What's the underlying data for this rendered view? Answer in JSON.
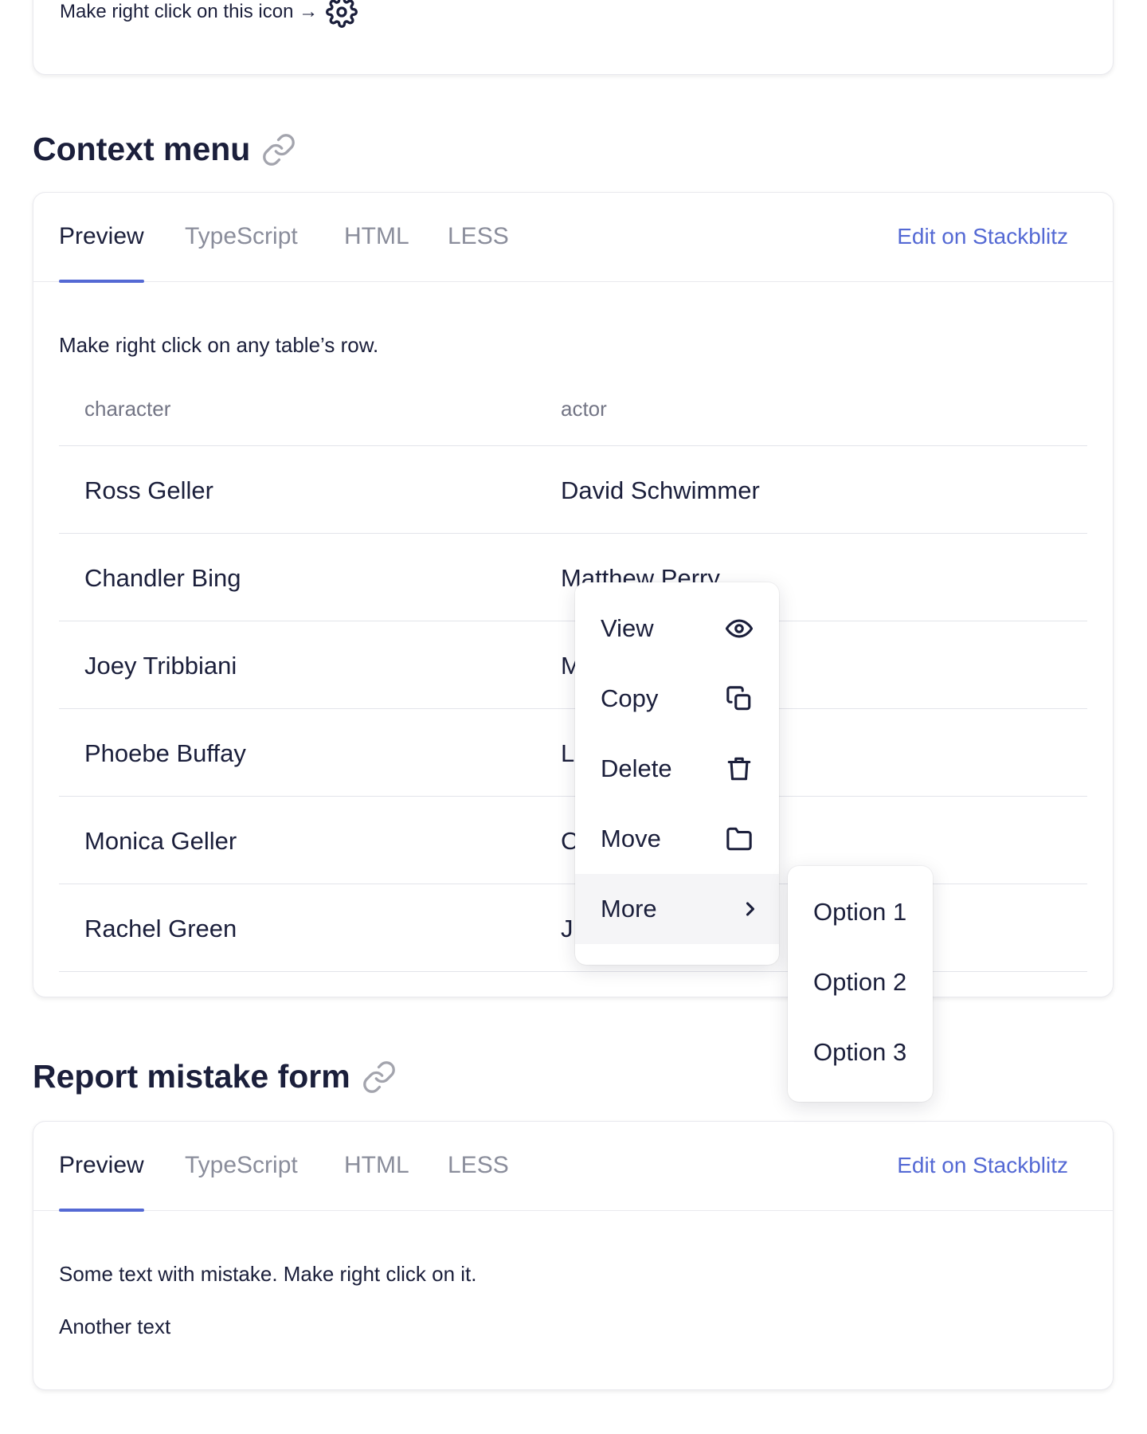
{
  "top_card": {
    "hint": "Make right click on this icon →",
    "icon": "gear-icon"
  },
  "context_section": {
    "title": "Context menu",
    "link_icon": "link-icon",
    "tabs": [
      "Preview",
      "TypeScript",
      "HTML",
      "LESS"
    ],
    "active_tab": "Preview",
    "edit_link": "Edit on Stackblitz",
    "hint": "Make right click on any table’s row.",
    "table": {
      "columns": [
        "character",
        "actor"
      ],
      "rows": [
        [
          "Ross Geller",
          "David Schwimmer"
        ],
        [
          "Chandler Bing",
          "Matthew Perry"
        ],
        [
          "Joey Tribbiani",
          "M"
        ],
        [
          "Phoebe Buffay",
          "L"
        ],
        [
          "Monica Geller",
          "C"
        ],
        [
          "Rachel Green",
          "J"
        ]
      ]
    }
  },
  "context_menu": {
    "items": [
      {
        "label": "View",
        "icon": "eye-icon"
      },
      {
        "label": "Copy",
        "icon": "copy-icon"
      },
      {
        "label": "Delete",
        "icon": "trash-icon"
      },
      {
        "label": "Move",
        "icon": "folder-icon"
      },
      {
        "label": "More",
        "icon": "chevron-right-icon"
      }
    ],
    "hovered": "More",
    "submenu": [
      "Option 1",
      "Option 2",
      "Option 3"
    ]
  },
  "report_section": {
    "title": "Report mistake form",
    "link_icon": "link-icon",
    "tabs": [
      "Preview",
      "TypeScript",
      "HTML",
      "LESS"
    ],
    "active_tab": "Preview",
    "edit_link": "Edit on Stackblitz",
    "text1": "Some text with mistake. Make right click on it.",
    "text2": "Another text"
  },
  "colors": {
    "accent": "#5469d4",
    "text": "#1b1f3b",
    "muted": "#8a8d9b",
    "border": "#e9e9ee"
  }
}
